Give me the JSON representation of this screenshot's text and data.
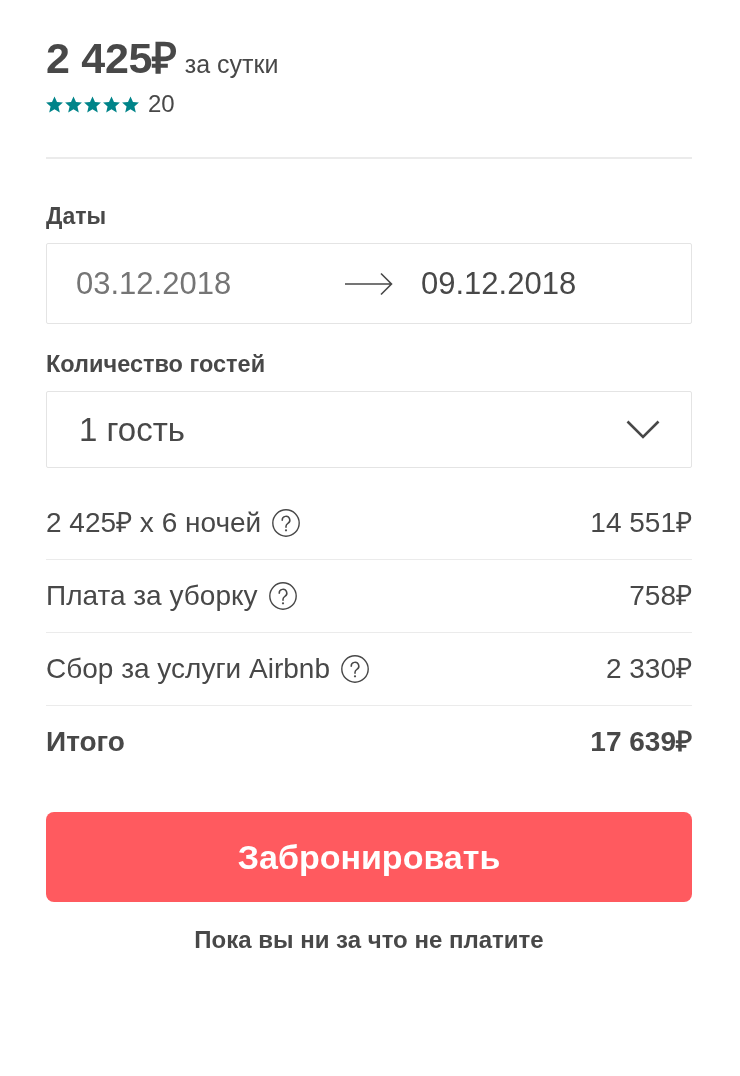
{
  "listing": {
    "price": "2 425₽",
    "price_unit": "за сутки",
    "stars": 5,
    "reviews_count": "20"
  },
  "dates": {
    "label": "Даты",
    "fields": [
      {
        "value": "03.12.2018",
        "dimmed": true
      },
      {
        "value": "09.12.2018",
        "dimmed": false
      }
    ]
  },
  "guests": {
    "label": "Количество гостей",
    "value": "1 гость"
  },
  "breakdown": [
    {
      "kind": "fee",
      "label": "2 425₽ x 6 ночей",
      "amount": "14 551₽"
    },
    {
      "kind": "fee",
      "label": "Плата за уборку",
      "amount": "758₽"
    },
    {
      "kind": "fee",
      "label": "Сбор за услуги Airbnb",
      "amount": "2 330₽"
    },
    {
      "kind": "total",
      "label": "Итого",
      "amount": "17 639₽"
    }
  ],
  "book_button": {
    "label": "Забронировать"
  },
  "note": "Пока вы ни за что не платите"
}
